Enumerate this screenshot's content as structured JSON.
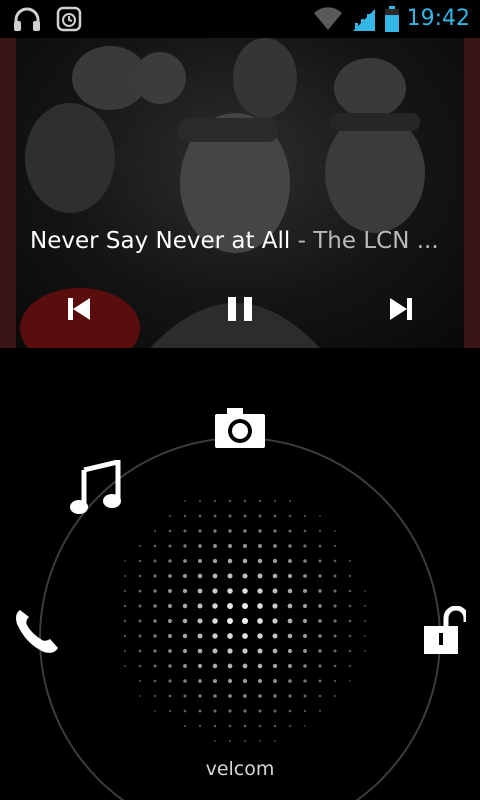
{
  "status_bar": {
    "left_icons": [
      "headphones-icon",
      "alarm-icon"
    ],
    "right_icons": [
      "wifi-icon",
      "cell-signal-icon",
      "battery-icon"
    ],
    "time": "19:42",
    "accent_color": "#33b5e5"
  },
  "music": {
    "title": "Never Say Never at All",
    "separator": " - ",
    "artist": "The LCN ...",
    "controls": [
      "previous-icon",
      "pause-icon",
      "next-icon"
    ]
  },
  "lockscreen": {
    "targets": [
      "camera-icon",
      "music-note-icon",
      "phone-icon",
      "unlock-icon"
    ],
    "carrier": "velcom"
  }
}
